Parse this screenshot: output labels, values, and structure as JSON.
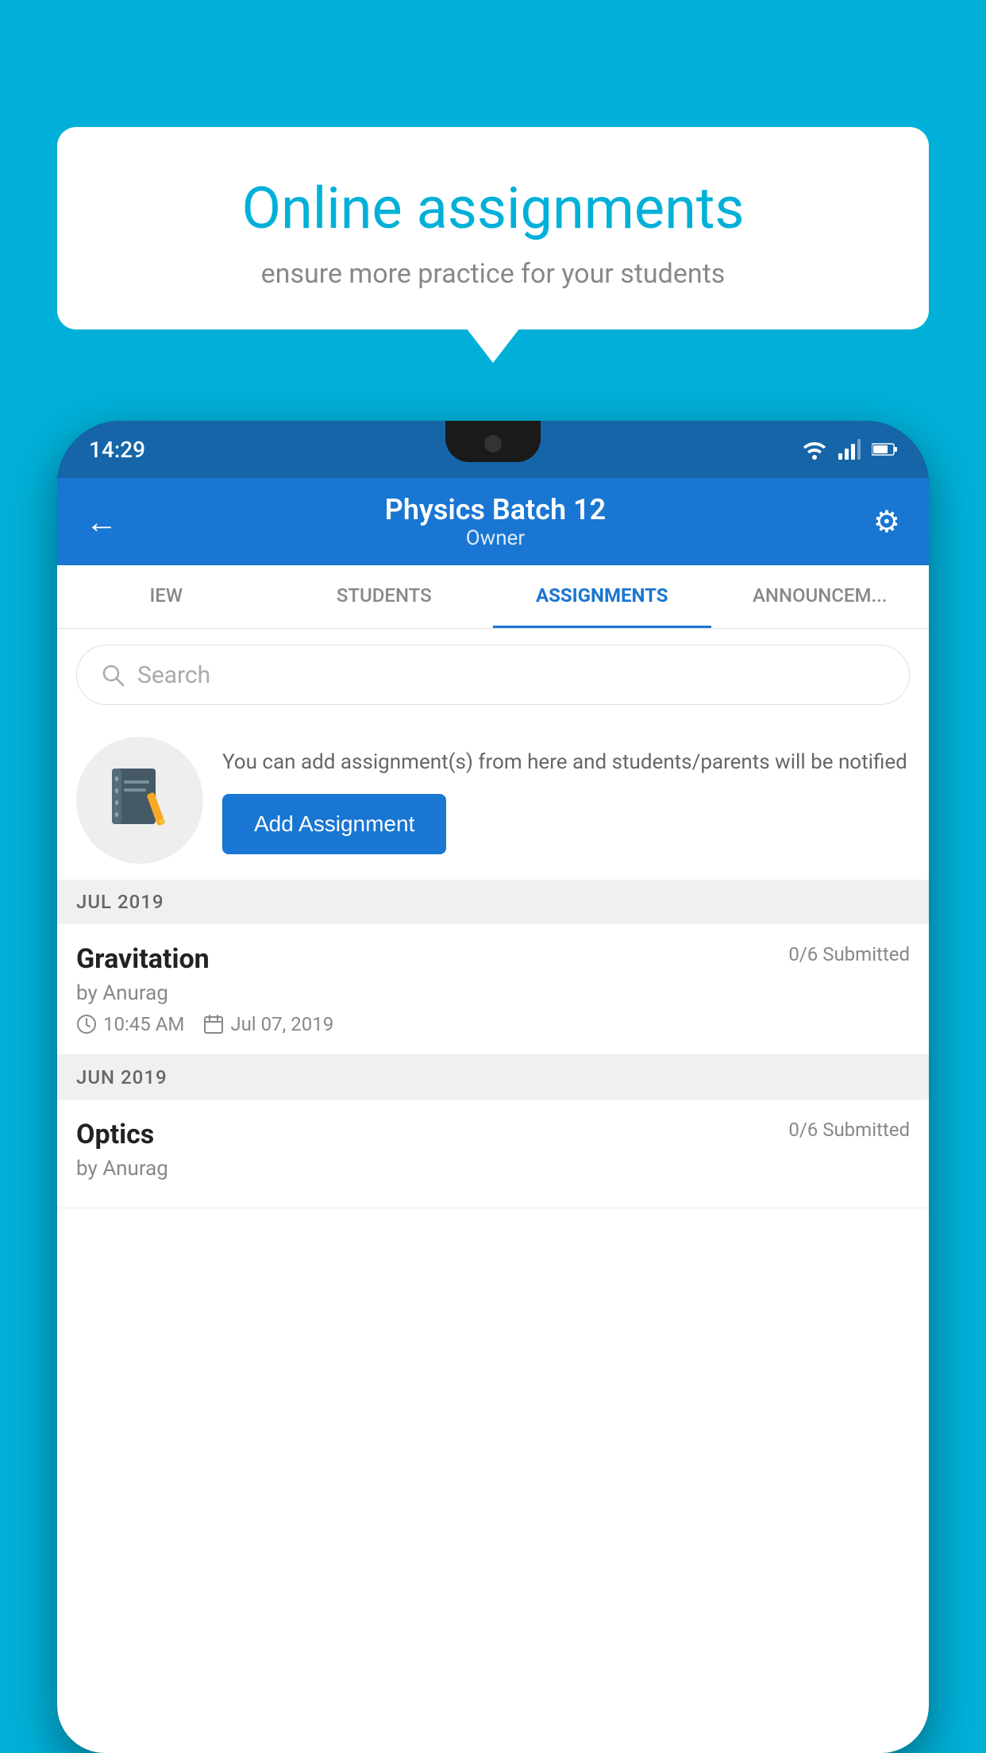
{
  "background_color": "#00b0d8",
  "speech_bubble": {
    "title": "Online assignments",
    "subtitle": "ensure more practice for your students"
  },
  "status_bar": {
    "time": "14:29",
    "wifi": "wifi",
    "signal": "signal",
    "battery": "battery"
  },
  "header": {
    "title": "Physics Batch 12",
    "subtitle": "Owner",
    "back_label": "←",
    "settings_label": "⚙"
  },
  "tabs": [
    {
      "label": "IEW",
      "active": false
    },
    {
      "label": "STUDENTS",
      "active": false
    },
    {
      "label": "ASSIGNMENTS",
      "active": true
    },
    {
      "label": "ANNOUNCEM...",
      "active": false
    }
  ],
  "search": {
    "placeholder": "Search"
  },
  "add_assignment": {
    "description": "You can add assignment(s) from here and students/parents will be notified",
    "button_label": "Add Assignment"
  },
  "sections": [
    {
      "month": "JUL 2019",
      "assignments": [
        {
          "name": "Gravitation",
          "submitted": "0/6 Submitted",
          "by": "by Anurag",
          "time": "10:45 AM",
          "date": "Jul 07, 2019"
        }
      ]
    },
    {
      "month": "JUN 2019",
      "assignments": [
        {
          "name": "Optics",
          "submitted": "0/6 Submitted",
          "by": "by Anurag",
          "time": "",
          "date": ""
        }
      ]
    }
  ]
}
